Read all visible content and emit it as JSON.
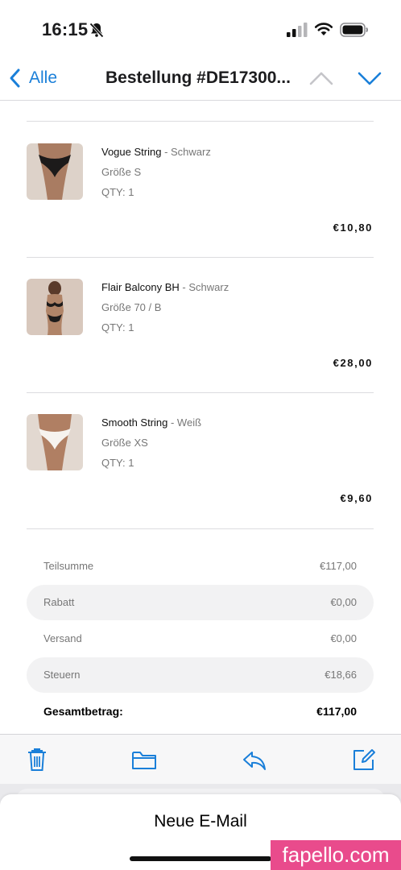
{
  "status": {
    "time": "16:15"
  },
  "nav": {
    "back_label": "Alle",
    "title": "Bestellung #DE17300..."
  },
  "items": [
    {
      "name": "Vogue String",
      "variant": " - Schwarz",
      "size": "Größe S",
      "qty": "QTY: 1",
      "price": "€10,80"
    },
    {
      "name": "Flair Balcony BH",
      "variant": " - Schwarz",
      "size": "Größe 70 / B",
      "qty": "QTY: 1",
      "price": "€28,00"
    },
    {
      "name": "Smooth String",
      "variant": " - Weiß",
      "size": "Größe XS",
      "qty": "QTY: 1",
      "price": "€9,60"
    }
  ],
  "totals": {
    "subtotal_label": "Teilsumme",
    "subtotal_value": "€117,00",
    "discount_label": "Rabatt",
    "discount_value": "€0,00",
    "shipping_label": "Versand",
    "shipping_value": "€0,00",
    "tax_label": "Steuern",
    "tax_value": "€18,66",
    "grand_label": "Gesamtbetrag:",
    "grand_value": "€117,00"
  },
  "compose": {
    "title": "Neue E-Mail"
  },
  "watermark": "fapello.com",
  "colors": {
    "accent": "#1a7fd9",
    "watermark": "#e94b8c"
  }
}
